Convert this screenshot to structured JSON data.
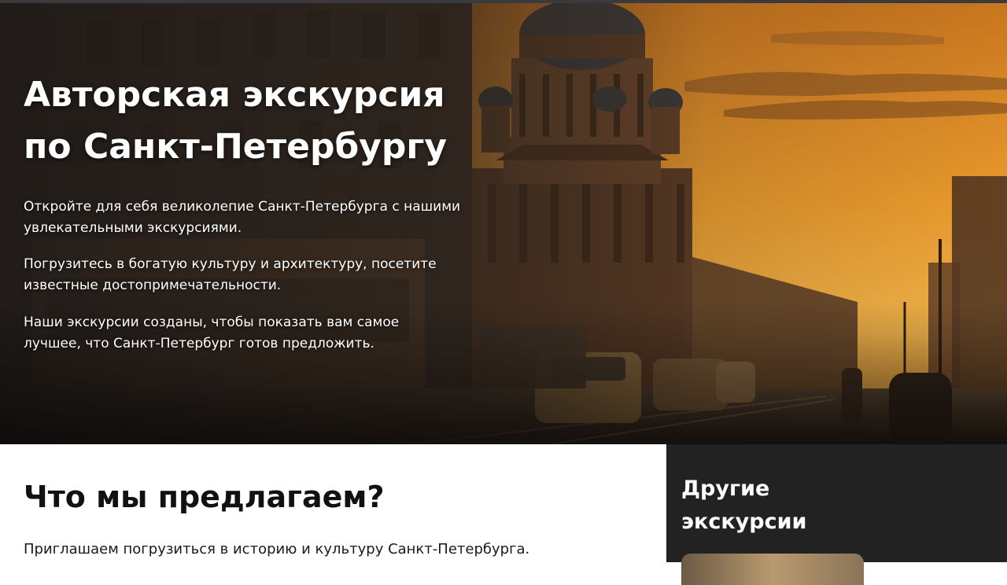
{
  "hero": {
    "title_line1": "Авторская экскурсия",
    "title_line2": "по Санкт-Петербургу",
    "p1_line1": "Откройте для себя великолепие Санкт-Петербурга с нашими",
    "p1_line2": "увлекательными экскурсиями.",
    "p2_line1": "Погрузитесь в богатую культуру и архитектуру, посетите",
    "p2_line2": "известные достопримечательности.",
    "p3_line1": "Наши экскурсии созданы, чтобы показать вам самое",
    "p3_line2": "лучшее, что Санкт-Петербург готов предложить."
  },
  "main": {
    "title": "Что мы предлагаем?",
    "text": "Приглашаем погрузиться в историю и культуру Санкт-Петербурга."
  },
  "sidebar": {
    "title_line1": "Другие",
    "title_line2": "экскурсии"
  },
  "colors": {
    "sky_top": "#d98a2a",
    "sky_bottom": "#f2b24a",
    "dark_panel": "#222222",
    "text_white": "#ffffff"
  }
}
